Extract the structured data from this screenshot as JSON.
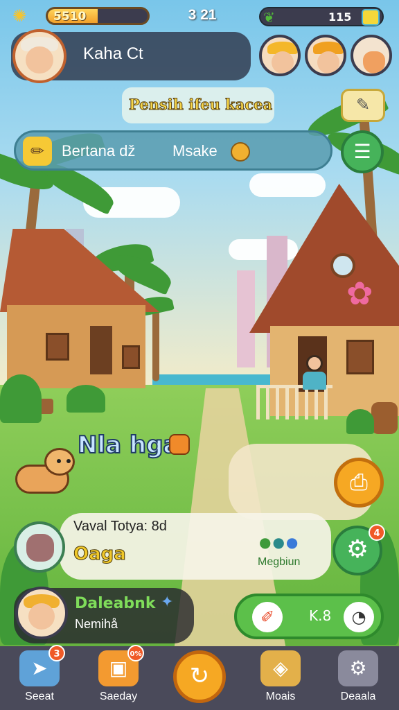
{
  "hud": {
    "energy_value": "5510",
    "energy_level": 0.5,
    "time": "3 21",
    "resource_value": "115"
  },
  "profile": {
    "name": "Kaha Ct"
  },
  "quest": {
    "banner_text": "Pensih ifeu kacea"
  },
  "task_bar": {
    "label": "Bertana dž",
    "action": "Msake"
  },
  "pet": {
    "label": "Nla hga"
  },
  "chat": {
    "title": "Vaval Totya: 8d",
    "value": "Oaga",
    "sub": "Megbiun"
  },
  "player": {
    "name": "Daleabnk",
    "status": "Nemihå"
  },
  "action": {
    "count": "K.8"
  },
  "badges": {
    "gear": "4",
    "nav_first": "3",
    "nav_second": "0%"
  },
  "nav": [
    {
      "label": "Seeat",
      "icon": "arrow-icon"
    },
    {
      "label": "Saeday",
      "icon": "bag-icon"
    },
    {
      "label": "",
      "icon": "refresh-icon"
    },
    {
      "label": "Moais",
      "icon": "ice-cream-icon"
    },
    {
      "label": "Deaala",
      "icon": "settings-icon"
    }
  ],
  "colors": {
    "accent_green": "#46b35a",
    "accent_orange": "#f6a823",
    "nav_bg": "#4a4a5a"
  }
}
